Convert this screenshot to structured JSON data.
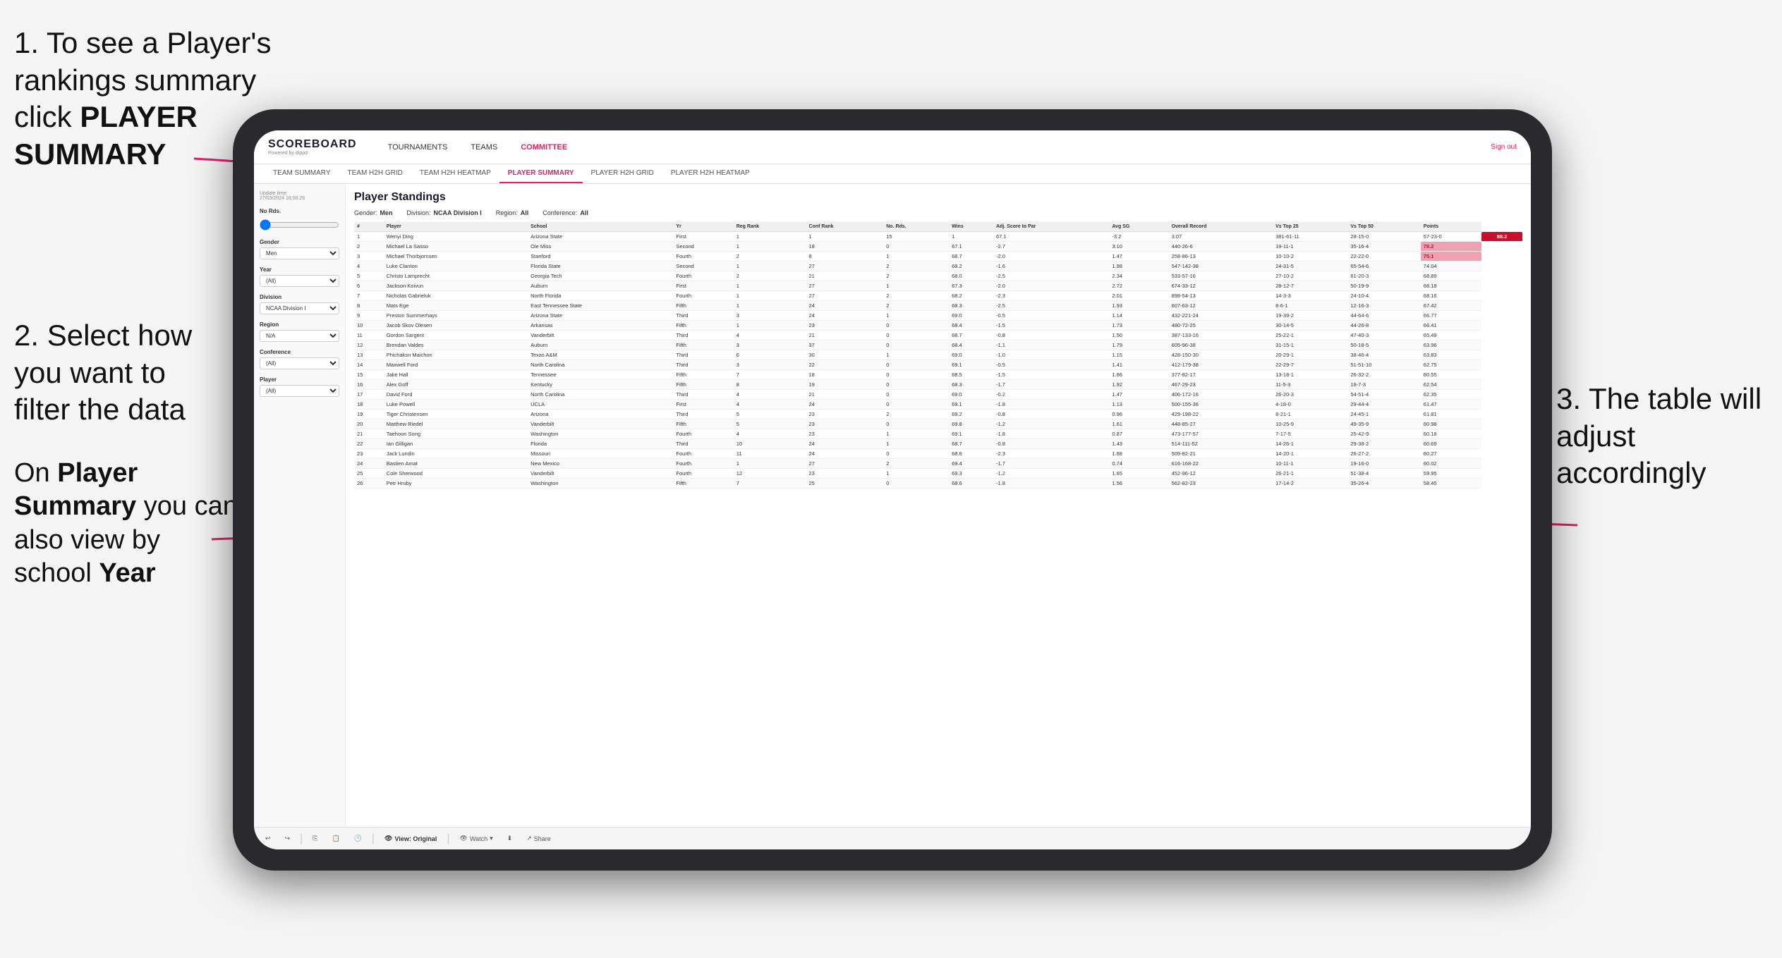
{
  "instructions": {
    "step1": "1. To see a Player's rankings summary click ",
    "step1_bold": "PLAYER SUMMARY",
    "step2_line1": "2. Select how you want to",
    "step2_line2": "filter the data",
    "step2_extra1": "On ",
    "step2_bold1": "Player Summary",
    "step2_extra2": " you can also view by school ",
    "step2_bold2": "Year",
    "step3": "3. The table will adjust accordingly"
  },
  "header": {
    "logo": "SCOREBOARD",
    "logo_sub": "Powered by dippd",
    "nav": [
      "TOURNAMENTS",
      "TEAMS",
      "COMMITTEE"
    ],
    "sign_out": "Sign out"
  },
  "sub_nav": {
    "items": [
      "TEAM SUMMARY",
      "TEAM H2H GRID",
      "TEAM H2H HEATMAP",
      "PLAYER SUMMARY",
      "PLAYER H2H GRID",
      "PLAYER H2H HEATMAP"
    ],
    "active": "PLAYER SUMMARY"
  },
  "sidebar": {
    "update_time_label": "Update time:",
    "update_time_val": "27/03/2024 16:56:26",
    "no_rds_label": "No Rds.",
    "gender_label": "Gender",
    "gender_val": "Men",
    "year_label": "Year",
    "year_val": "(All)",
    "division_label": "Division",
    "division_val": "NCAA Division I",
    "region_label": "Region",
    "region_val": "N/A",
    "conference_label": "Conference",
    "conference_val": "(All)",
    "player_label": "Player",
    "player_val": "(All)"
  },
  "table": {
    "title": "Player Standings",
    "filters": {
      "gender_label": "Gender:",
      "gender_val": "Men",
      "division_label": "Division:",
      "division_val": "NCAA Division I",
      "region_label": "Region:",
      "region_val": "All",
      "conference_label": "Conference:",
      "conference_val": "All"
    },
    "columns": [
      "#",
      "Player",
      "School",
      "Yr",
      "Reg Rank",
      "Conf Rank",
      "No. Rds.",
      "Wins",
      "Adj. Score to Par",
      "Avg SG",
      "Overall Record",
      "Vs Top 25",
      "Vs Top 50",
      "Points"
    ],
    "rows": [
      [
        "1",
        "Wenyi Ding",
        "Arizona State",
        "First",
        "1",
        "1",
        "15",
        "1",
        "67.1",
        "-3.2",
        "3.07",
        "381-61-11",
        "28-15-0",
        "57-23-0",
        "88.2"
      ],
      [
        "2",
        "Michael La Sasso",
        "Ole Miss",
        "Second",
        "1",
        "18",
        "0",
        "67.1",
        "-2.7",
        "3.10",
        "440-26-6",
        "19-11-1",
        "35-16-4",
        "78.2"
      ],
      [
        "3",
        "Michael Thorbjornsen",
        "Stanford",
        "Fourth",
        "2",
        "8",
        "1",
        "68.7",
        "-2.0",
        "1.47",
        "258-86-13",
        "10-10-2",
        "22-22-0",
        "75.1"
      ],
      [
        "4",
        "Luke Clanton",
        "Florida State",
        "Second",
        "1",
        "27",
        "2",
        "68.2",
        "-1.6",
        "1.98",
        "547-142-38",
        "24-31-5",
        "65-54-6",
        "74.04"
      ],
      [
        "5",
        "Christo Lamprecht",
        "Georgia Tech",
        "Fourth",
        "2",
        "21",
        "2",
        "68.0",
        "-2.5",
        "2.34",
        "533-57-16",
        "27-10-2",
        "61-20-3",
        "68.89"
      ],
      [
        "6",
        "Jackson Koivun",
        "Auburn",
        "First",
        "1",
        "27",
        "1",
        "67.3",
        "-2.0",
        "2.72",
        "674-33-12",
        "28-12-7",
        "50-19-9",
        "68.18"
      ],
      [
        "7",
        "Nicholas Gabrieluk",
        "North Florida",
        "Fourth",
        "1",
        "27",
        "2",
        "68.2",
        "-2.3",
        "2.01",
        "898-54-13",
        "14-3-3",
        "24-10-4",
        "68.16"
      ],
      [
        "8",
        "Mats Ege",
        "East Tennessee State",
        "Fifth",
        "1",
        "24",
        "2",
        "68.3",
        "-2.5",
        "1.93",
        "607-63-12",
        "8-6-1",
        "12-16-3",
        "67.42"
      ],
      [
        "9",
        "Preston Summerhays",
        "Arizona State",
        "Third",
        "3",
        "24",
        "1",
        "69.0",
        "-0.5",
        "1.14",
        "432-221-24",
        "19-39-2",
        "44-64-6",
        "66.77"
      ],
      [
        "10",
        "Jacob Skov Olesen",
        "Arkansas",
        "Fifth",
        "1",
        "23",
        "0",
        "68.4",
        "-1.5",
        "1.73",
        "480-72-25",
        "30-14-5",
        "44-26-8",
        "66.41"
      ],
      [
        "11",
        "Gordon Sargent",
        "Vanderbilt",
        "Third",
        "4",
        "21",
        "0",
        "68.7",
        "-0.8",
        "1.50",
        "387-133-16",
        "25-22-1",
        "47-40-3",
        "65.49"
      ],
      [
        "12",
        "Brendan Valdes",
        "Auburn",
        "Fifth",
        "3",
        "37",
        "0",
        "68.4",
        "-1.1",
        "1.79",
        "605-96-38",
        "31-15-1",
        "50-18-5",
        "63.96"
      ],
      [
        "13",
        "Phichaksn Maichon",
        "Texas A&M",
        "Third",
        "6",
        "30",
        "1",
        "69.0",
        "-1.0",
        "1.15",
        "428-150-30",
        "20-29-1",
        "38-46-4",
        "63.83"
      ],
      [
        "14",
        "Maxwell Ford",
        "North Carolina",
        "Third",
        "3",
        "22",
        "0",
        "69.1",
        "-0.5",
        "1.41",
        "412-179-38",
        "22-29-7",
        "51-51-10",
        "62.75"
      ],
      [
        "15",
        "Jake Hall",
        "Tennessee",
        "Fifth",
        "7",
        "18",
        "0",
        "68.5",
        "-1.5",
        "1.66",
        "377-82-17",
        "13-18-1",
        "26-32-2",
        "60.55"
      ],
      [
        "16",
        "Alex Goff",
        "Kentucky",
        "Fifth",
        "8",
        "19",
        "0",
        "68.3",
        "-1.7",
        "1.92",
        "467-29-23",
        "11-5-3",
        "18-7-3",
        "62.54"
      ],
      [
        "17",
        "David Ford",
        "North Carolina",
        "Third",
        "4",
        "21",
        "0",
        "69.0",
        "-0.2",
        "1.47",
        "406-172-16",
        "26-20-3",
        "54-51-4",
        "62.35"
      ],
      [
        "18",
        "Luke Powell",
        "UCLA",
        "First",
        "4",
        "24",
        "0",
        "69.1",
        "-1.8",
        "1.13",
        "500-155-36",
        "4-18-0",
        "29-44-4",
        "61.47"
      ],
      [
        "19",
        "Tiger Christensen",
        "Arizona",
        "Third",
        "5",
        "23",
        "2",
        "69.2",
        "-0.8",
        "0.96",
        "429-198-22",
        "8-21-1",
        "24-45-1",
        "61.81"
      ],
      [
        "20",
        "Matthew Riedel",
        "Vanderbilt",
        "Fifth",
        "5",
        "23",
        "0",
        "69.8",
        "-1.2",
        "1.61",
        "448-85-27",
        "10-25-9",
        "49-35-9",
        "60.98"
      ],
      [
        "21",
        "Taehoon Song",
        "Washington",
        "Fourth",
        "4",
        "23",
        "1",
        "69.1",
        "-1.8",
        "0.87",
        "473-177-57",
        "7-17-5",
        "25-42-9",
        "60.18"
      ],
      [
        "22",
        "Ian Gilligan",
        "Florida",
        "Third",
        "10",
        "24",
        "1",
        "68.7",
        "-0.8",
        "1.43",
        "514-111-52",
        "14-26-1",
        "29-38-2",
        "60.69"
      ],
      [
        "23",
        "Jack Lundin",
        "Missouri",
        "Fourth",
        "11",
        "24",
        "0",
        "68.6",
        "-2.3",
        "1.68",
        "509-82-21",
        "14-20-1",
        "26-27-2",
        "60.27"
      ],
      [
        "24",
        "Bastien Amat",
        "New Mexico",
        "Fourth",
        "1",
        "27",
        "2",
        "69.4",
        "-1.7",
        "0.74",
        "616-168-22",
        "10-11-1",
        "19-16-0",
        "60.02"
      ],
      [
        "25",
        "Cole Sherwood",
        "Vanderbilt",
        "Fourth",
        "12",
        "23",
        "1",
        "69.3",
        "-1.2",
        "1.65",
        "452-96-12",
        "26-21-1",
        "51-38-4",
        "59.95"
      ],
      [
        "26",
        "Petr Hruby",
        "Washington",
        "Fifth",
        "7",
        "25",
        "0",
        "68.6",
        "-1.8",
        "1.56",
        "562-82-23",
        "17-14-2",
        "35-26-4",
        "58.45"
      ]
    ]
  },
  "toolbar": {
    "undo": "↩",
    "redo": "↪",
    "view_original": "View: Original",
    "watch": "Watch",
    "share": "Share"
  }
}
